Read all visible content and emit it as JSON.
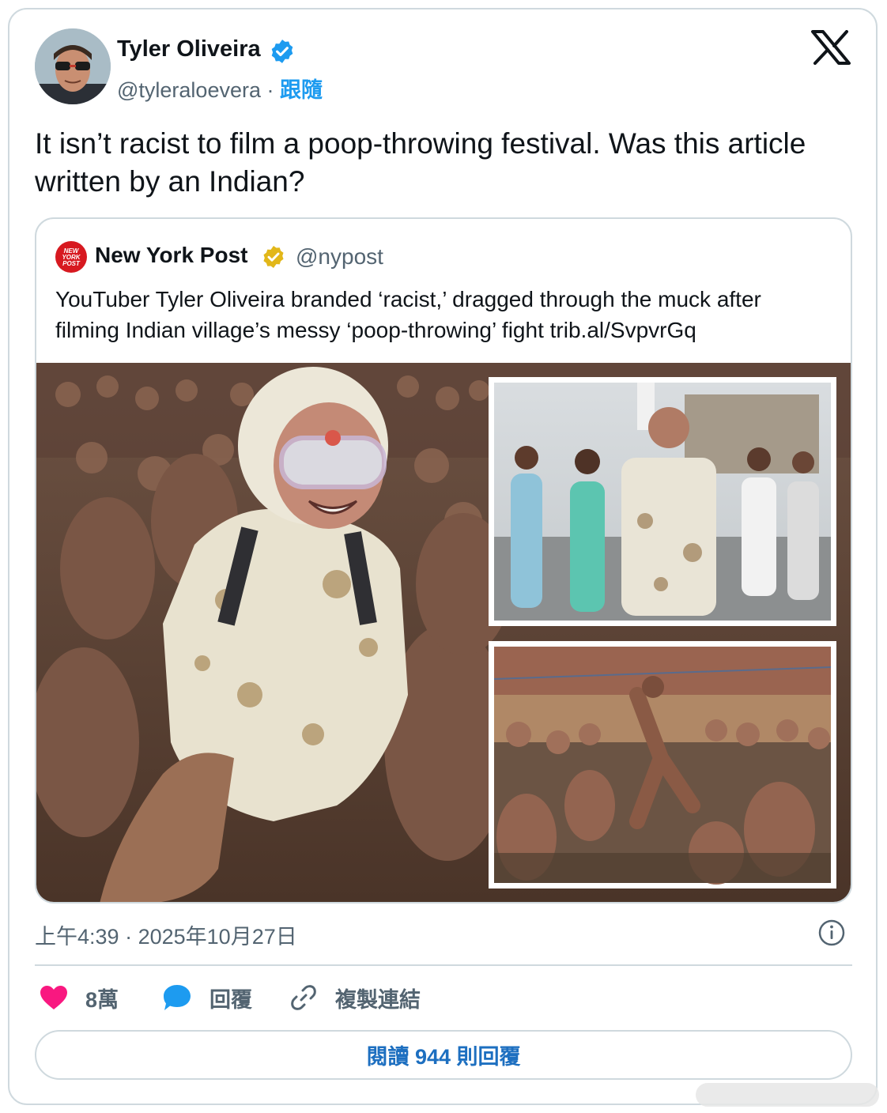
{
  "tweet": {
    "author_name": "Tyler Oliveira",
    "handle": "@tyleraloevera",
    "separator": "·",
    "follow_label": "跟隨",
    "text": "It isn’t racist to film a poop-throwing festival. Was this article written by an Indian?",
    "time": "上午4:39",
    "date": "2025年10月27日"
  },
  "quote": {
    "logo_text": "NEW YORK POST",
    "author_name": "New York Post",
    "handle": "@nypost",
    "text": "YouTuber Tyler Oliveira branded ‘racist,’ dragged through the muck after filming Indian village’s messy ‘poop-throwing’ fight trib.al/SvpvrGq"
  },
  "actions": {
    "likes": "8萬",
    "reply": "回覆",
    "copy_link": "複製連結",
    "read_replies": "閱讀 944 則回覆"
  },
  "colors": {
    "brand_blue": "#1d9bf0",
    "like_pink": "#f91880",
    "nypost_red": "#d71920",
    "gold_check": "#e2b719"
  },
  "icons": [
    "verified-badge-icon",
    "x-logo-icon",
    "gold-verified-icon",
    "info-icon",
    "heart-icon",
    "reply-bubble-icon",
    "link-icon"
  ]
}
